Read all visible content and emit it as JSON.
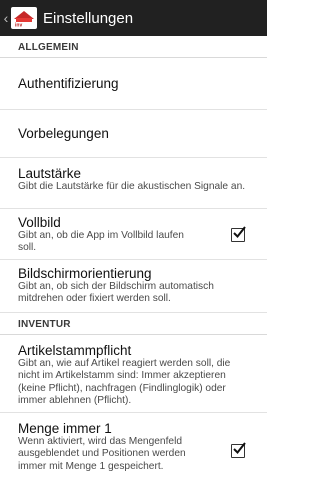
{
  "appbar": {
    "back_icon": "chevron-left",
    "logo_icon": "app-logo",
    "title": "Einstellungen"
  },
  "sections": [
    {
      "header": "ALLGEMEIN",
      "items": [
        {
          "title": "Authentifizierung"
        },
        {
          "title": "Vorbelegungen"
        },
        {
          "title": "Lautstärke",
          "summary": "Gibt die Lautstärke für die akustischen Signale an."
        },
        {
          "title": "Vollbild",
          "summary": "Gibt an, ob die App im Vollbild laufen soll.",
          "checked": true
        },
        {
          "title": "Bildschirmorientierung",
          "summary": "Gibt an, ob sich der Bildschirm automatisch mitdrehen oder fixiert werden soll."
        }
      ]
    },
    {
      "header": "INVENTUR",
      "items": [
        {
          "title": "Artikelstammpflicht",
          "summary": "Gibt an, wie auf Artikel reagiert werden soll, die nicht im Artikelstamm sind: Immer akzeptieren (keine Pflicht), nachfragen (Findlinglogik) oder immer ablehnen (Pflicht)."
        },
        {
          "title": "Menge immer 1",
          "summary": "Wenn aktiviert, wird das Mengenfeld ausgeblendet und Positionen werden immer mit Menge 1 gespeichert.",
          "checked": true
        }
      ]
    }
  ]
}
